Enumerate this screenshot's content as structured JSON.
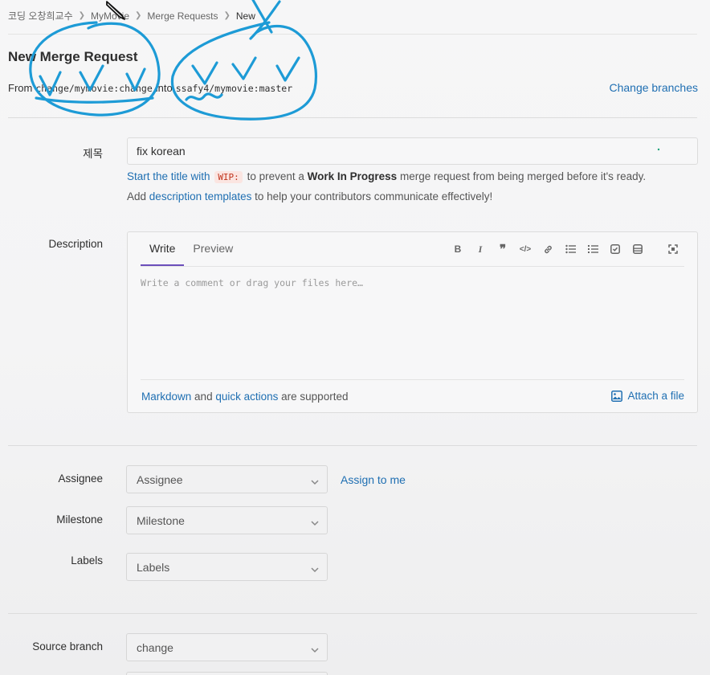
{
  "breadcrumb": {
    "items": [
      "코딩 오창희교수",
      "MyMovie",
      "Merge Requests"
    ],
    "current": "New"
  },
  "page": {
    "title": "New Merge Request",
    "from_label": "From",
    "source_ref": "change/mymovie:change",
    "into_label": "into",
    "target_ref": "ssafy4/mymovie:master",
    "change_branches": "Change branches"
  },
  "title_field": {
    "label": "제목",
    "value": "fix korean",
    "hint_prefix": "Start the title with",
    "hint_code": "WIP:",
    "hint_mid": "to prevent a",
    "hint_bold": "Work In Progress",
    "hint_suffix": "merge request from being merged before it's ready.",
    "templates_prefix": "Add",
    "templates_link": "description templates",
    "templates_suffix": "to help your contributors communicate effectively!"
  },
  "description": {
    "label": "Description",
    "tab_write": "Write",
    "tab_preview": "Preview",
    "placeholder": "Write a comment or drag your files here…",
    "markdown_link": "Markdown",
    "and": "and",
    "quick_actions_link": "quick actions",
    "supported": "are supported",
    "attach": "Attach a file",
    "toolbar_icons": [
      "bold-icon",
      "italic-icon",
      "quote-icon",
      "code-icon",
      "link-icon",
      "bullet-list-icon",
      "numbered-list-icon",
      "task-list-icon",
      "table-icon",
      "fullscreen-icon"
    ]
  },
  "assignee": {
    "label": "Assignee",
    "value": "Assignee",
    "assign_me": "Assign to me"
  },
  "milestone": {
    "label": "Milestone",
    "value": "Milestone"
  },
  "labels": {
    "label": "Labels",
    "value": "Labels"
  },
  "source_branch": {
    "label": "Source branch",
    "value": "change"
  },
  "colors": {
    "link": "#1f6fb2",
    "active_tab": "#6b4fbb",
    "annotation_ink": "#1d9bd6"
  }
}
